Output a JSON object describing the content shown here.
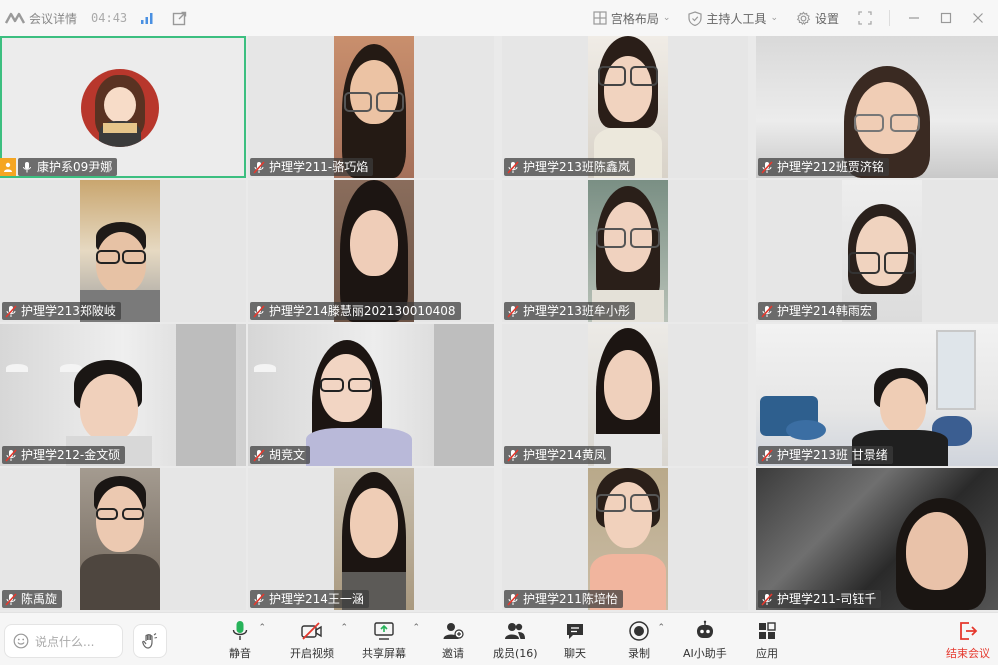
{
  "topbar": {
    "meeting_details": "会议详情",
    "timer": "04:43",
    "layout_label": "宫格布局",
    "host_tools_label": "主持人工具",
    "settings_label": "设置"
  },
  "participants": [
    {
      "name": "康护系09尹娜",
      "host": true
    },
    {
      "name": "护理学211-骆巧焰"
    },
    {
      "name": "护理学213班陈鑫岚"
    },
    {
      "name": "护理学212班贾济铭"
    },
    {
      "name": "护理学213郑陂岐"
    },
    {
      "name": "护理学214滕慧丽202130010408"
    },
    {
      "name": "护理学213班牟小彤"
    },
    {
      "name": "护理学214韩雨宏"
    },
    {
      "name": "护理学212-金文硕"
    },
    {
      "name": "胡竞文"
    },
    {
      "name": "护理学214黄凤"
    },
    {
      "name": "护理学213班 甘景绪"
    },
    {
      "name": "陈禹旋"
    },
    {
      "name": "护理学214王一涵"
    },
    {
      "name": "护理学211陈培怡"
    },
    {
      "name": "护理学211-司钰千"
    }
  ],
  "bottombar": {
    "chat_placeholder": "说点什么...",
    "mute_label": "静音",
    "video_label": "开启视频",
    "share_label": "共享屏幕",
    "invite_label": "邀请",
    "members_label": "成员(16)",
    "chat_label": "聊天",
    "record_label": "录制",
    "ai_label": "AI小助手",
    "apps_label": "应用",
    "end_label": "结束会议"
  },
  "colors": {
    "active_speaker": "#3cbf80",
    "end_meeting": "#e5382d",
    "mic_active": "#27b35a",
    "share_active": "#27b35a"
  }
}
